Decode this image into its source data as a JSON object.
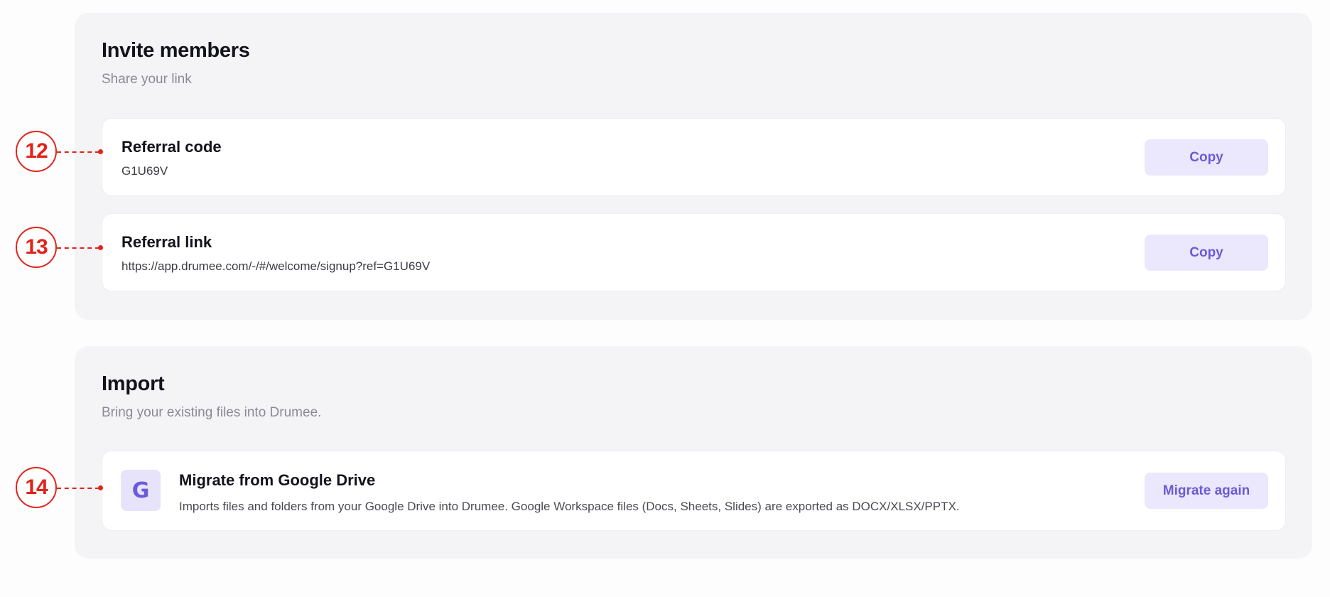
{
  "invite": {
    "title": "Invite members",
    "subtitle": "Share your link",
    "referral_code": {
      "label": "Referral code",
      "value": "G1U69V",
      "button": "Copy"
    },
    "referral_link": {
      "label": "Referral link",
      "value": "https://app.drumee.com/-/#/welcome/signup?ref=G1U69V",
      "button": "Copy"
    }
  },
  "import": {
    "title": "Import",
    "subtitle": "Bring your existing files into Drumee.",
    "google_drive": {
      "icon": "google-g-icon",
      "icon_letter": "G",
      "label": "Migrate from Google Drive",
      "description": "Imports files and folders from your Google Drive into Drumee. Google Workspace files (Docs, Sheets, Slides) are exported as DOCX/XLSX/PPTX.",
      "button": "Migrate again"
    }
  },
  "markers": [
    {
      "number": "12"
    },
    {
      "number": "13"
    },
    {
      "number": "14"
    }
  ],
  "colors": {
    "accent": "#6a5bd9",
    "button_bg": "#ebe8fd",
    "section_bg": "#f4f4f7",
    "marker_red": "#e2231a"
  }
}
